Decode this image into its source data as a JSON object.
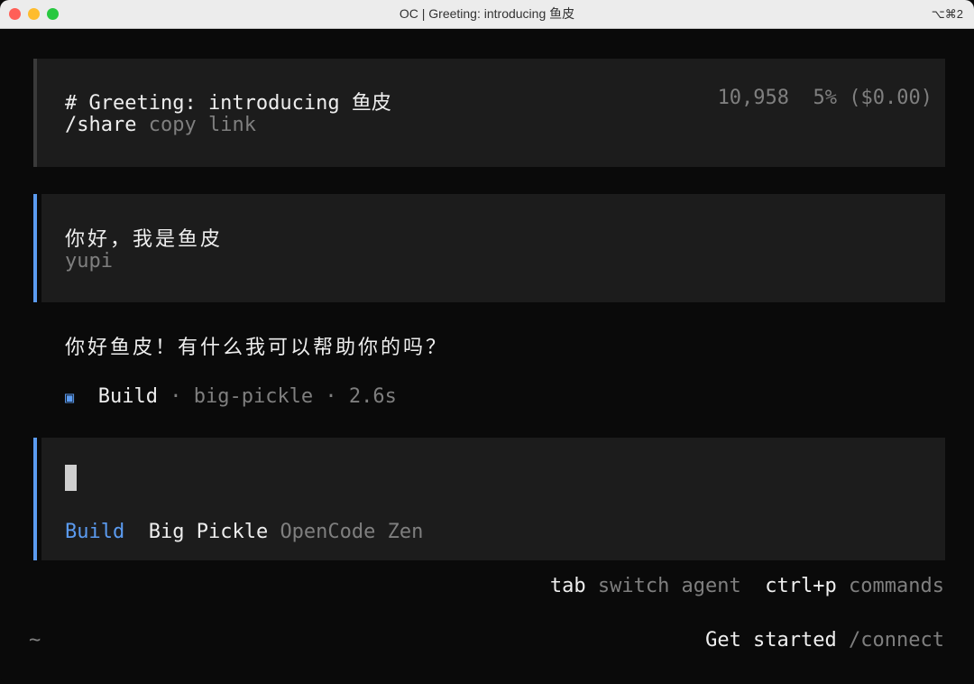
{
  "window": {
    "title": "OC | Greeting: introducing 鱼皮",
    "shortcut": "⌥⌘2"
  },
  "header": {
    "heading": "# Greeting: introducing 鱼皮",
    "tokens": "10,958",
    "usage": "5% ($0.00)",
    "share_command": "/share",
    "share_hint": "copy link"
  },
  "user_message": {
    "text": "你好，我是鱼皮",
    "author": "yupi"
  },
  "assistant_message": {
    "text": "你好鱼皮！有什么我可以帮助你的吗？",
    "agent_icon": "▣",
    "agent": "Build",
    "meta": "· big-pickle · 2.6s"
  },
  "input": {
    "agent": "Build",
    "model": "Big Pickle",
    "provider": "OpenCode Zen"
  },
  "hints": {
    "tab_key": "tab",
    "tab_label": "switch agent",
    "cmd_key": "ctrl+p",
    "cmd_label": "commands"
  },
  "footer": {
    "cwd": "~",
    "get_started": "Get started",
    "connect": "/connect"
  },
  "colors": {
    "accent_blue": "#5b9bf0",
    "panel_bg": "#1c1c1c",
    "terminal_bg": "#0a0a0a"
  }
}
